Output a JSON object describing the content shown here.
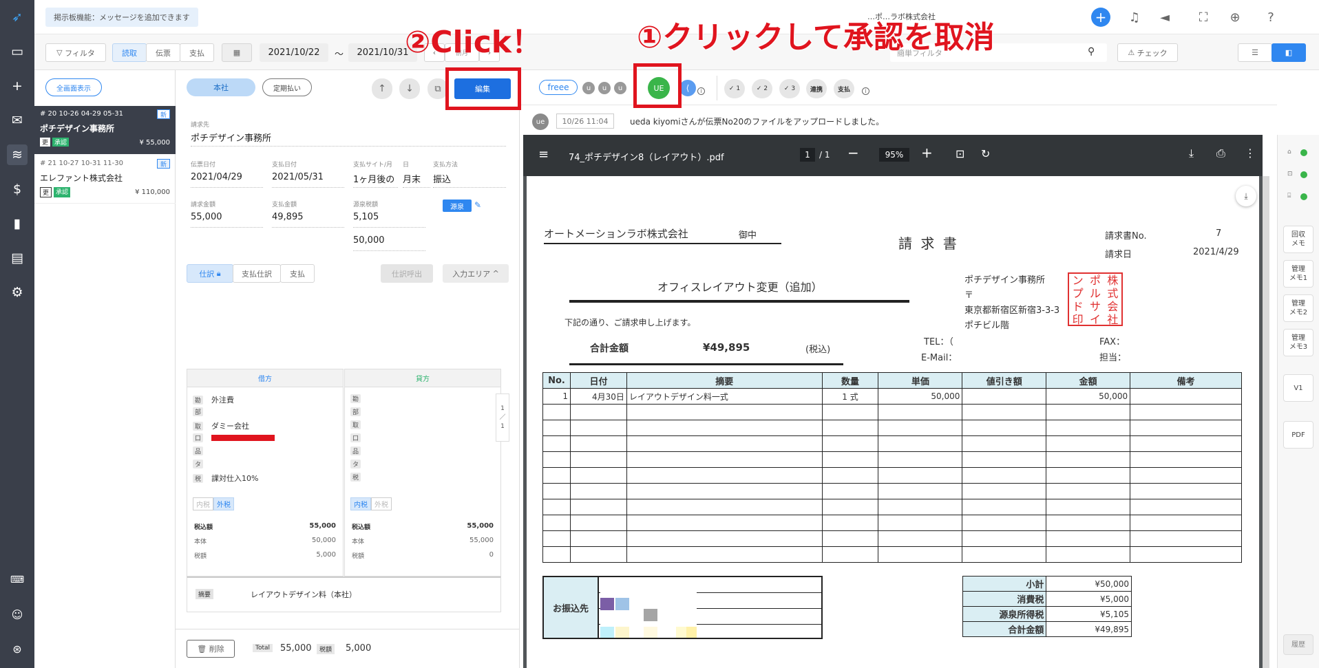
{
  "top": {
    "notice": "掲示板機能：メッセージを追加できます",
    "company": "…ポ…ラボ株式会社"
  },
  "filterbar": {
    "filter": "フィルタ",
    "tabs": [
      "読取",
      "伝票",
      "支払"
    ],
    "date_from": "2021/10/22",
    "tilde": "〜",
    "date_to": "2021/10/31",
    "prev_month": "前月",
    "search_placeholder": "簡単フィルタ",
    "check": "チェック"
  },
  "list": {
    "fullscreen": "全画面表示",
    "items": [
      {
        "meta": "# 20  10-26  04-29  05-31",
        "new": "新",
        "name": "ポチデザイン事務所",
        "tag1": "更",
        "tag2": "承認",
        "amount": "¥ 55,000"
      },
      {
        "meta": "# 21  10-27  10-31  11-30",
        "new": "新",
        "name": "エレファント株式会社",
        "tag1": "更",
        "tag2": "承認",
        "amount": "¥ 110,000"
      }
    ]
  },
  "detail": {
    "honsha": "本社",
    "teiki": "定期払い",
    "edit": "編集",
    "client_label": "請求先",
    "client": "ポチデザイン事務所",
    "fields": [
      {
        "label": "伝票日付",
        "value": "2021/04/29"
      },
      {
        "label": "支払日付",
        "value": "2021/05/31"
      },
      {
        "label": "支払サイト/月",
        "value": "1ヶ月後の"
      },
      {
        "label": "日",
        "value": "月末"
      },
      {
        "label": "支払方法",
        "value": "振込"
      },
      {
        "label": "請求金額",
        "value": "55,000"
      },
      {
        "label": "支払金額",
        "value": "49,895"
      },
      {
        "label": "源泉税額",
        "value": "5,105"
      },
      {
        "label": "",
        "value": "50,000"
      }
    ],
    "gensen": "源泉",
    "subtabs": [
      "仕訳",
      "支払仕訳",
      "支払"
    ],
    "shiwake_call": "仕訳呼出",
    "input_area": "入力エリア",
    "debit": "借方",
    "credit": "貸方",
    "row_tags": [
      "勘",
      "部",
      "取",
      "口",
      "品",
      "タ",
      "税"
    ],
    "debit_values": [
      "外注費",
      "",
      "ダミー会社",
      "",
      "",
      "",
      "課対仕入10%"
    ],
    "tax_in": "内税",
    "tax_out": "外税",
    "debit_sums": [
      {
        "label": "税込額",
        "value": "55,000"
      },
      {
        "label": "本体",
        "value": "50,000"
      },
      {
        "label": "税額",
        "value": "5,000"
      }
    ],
    "credit_sums": [
      {
        "label": "税込額",
        "value": "55,000"
      },
      {
        "label": "本体",
        "value": "55,000"
      },
      {
        "label": "税額",
        "value": "0"
      }
    ],
    "page_ind": [
      "1",
      "／",
      "1"
    ],
    "memo_tag": "摘要",
    "memo": "レイアウトデザイン料（本社）",
    "delete": "削除",
    "total_label": "Total",
    "total": "55,000",
    "tax_label": "税額",
    "tax_total": "5,000"
  },
  "viewer": {
    "freee": "freee",
    "approvals": [
      "u",
      "u",
      "u"
    ],
    "ue": "UE",
    "checks": [
      "✓ 1",
      "✓ 2",
      "✓ 3",
      "連携",
      "支払"
    ],
    "log_avatar": "ue",
    "log_time": "10/26 11:04",
    "log_text": "ueda kiyomiさんが伝票No20のファイルをアップロードしました。"
  },
  "pdf": {
    "filename": "74_ポチデザイン8（レイアウト）.pdf",
    "page": "1",
    "pages": "/ 1",
    "zoom": "95%"
  },
  "invoice": {
    "to": "オートメーションラボ株式会社",
    "onchu": "御中",
    "title": "請 求 書",
    "no_label": "請求書No.",
    "no": "7",
    "date_label": "請求日",
    "date": "2021/4/29",
    "subject": "オフィスレイアウト変更（追加）",
    "issuer": "ポチデザイン事務所",
    "zip": "〒",
    "addr": "東京都新宿区新宿3-3-3",
    "bldg": "ポチビル階",
    "tel": "TEL：（",
    "fax": "FAX：",
    "email": "E-Mail：",
    "tanto": "担当：",
    "greet": "下記の通り、ご請求申し上げます。",
    "total_label": "合計金額",
    "total": "¥49,895",
    "zeikomi": "(税込)",
    "headers": [
      "No.",
      "日付",
      "摘要",
      "数量",
      "単価",
      "値引き額",
      "金額",
      "備考"
    ],
    "row1": [
      "1",
      "4月30日",
      "レイアウトデザイン料一式",
      "1 式",
      "50,000",
      "",
      "50,000",
      ""
    ],
    "bank_label": "お振込先",
    "summary": [
      {
        "label": "小計",
        "value": "¥50,000"
      },
      {
        "label": "消費税",
        "value": "¥5,000"
      },
      {
        "label": "源泉所得税",
        "value": "¥5,105"
      },
      {
        "label": "合計金額",
        "value": "¥49,895"
      }
    ],
    "seal": [
      "ポ株",
      "チ式",
      "デ会",
      "ザ社",
      "イ印",
      "ン"
    ]
  },
  "right_tabs": [
    "回収\nメモ",
    "管理\nメモ1",
    "管理\nメモ2",
    "管理\nメモ3",
    "V1",
    "PDF",
    "履歴"
  ],
  "annotations": {
    "a1": "①クリックして承認を取消",
    "a2": "②Click！"
  }
}
